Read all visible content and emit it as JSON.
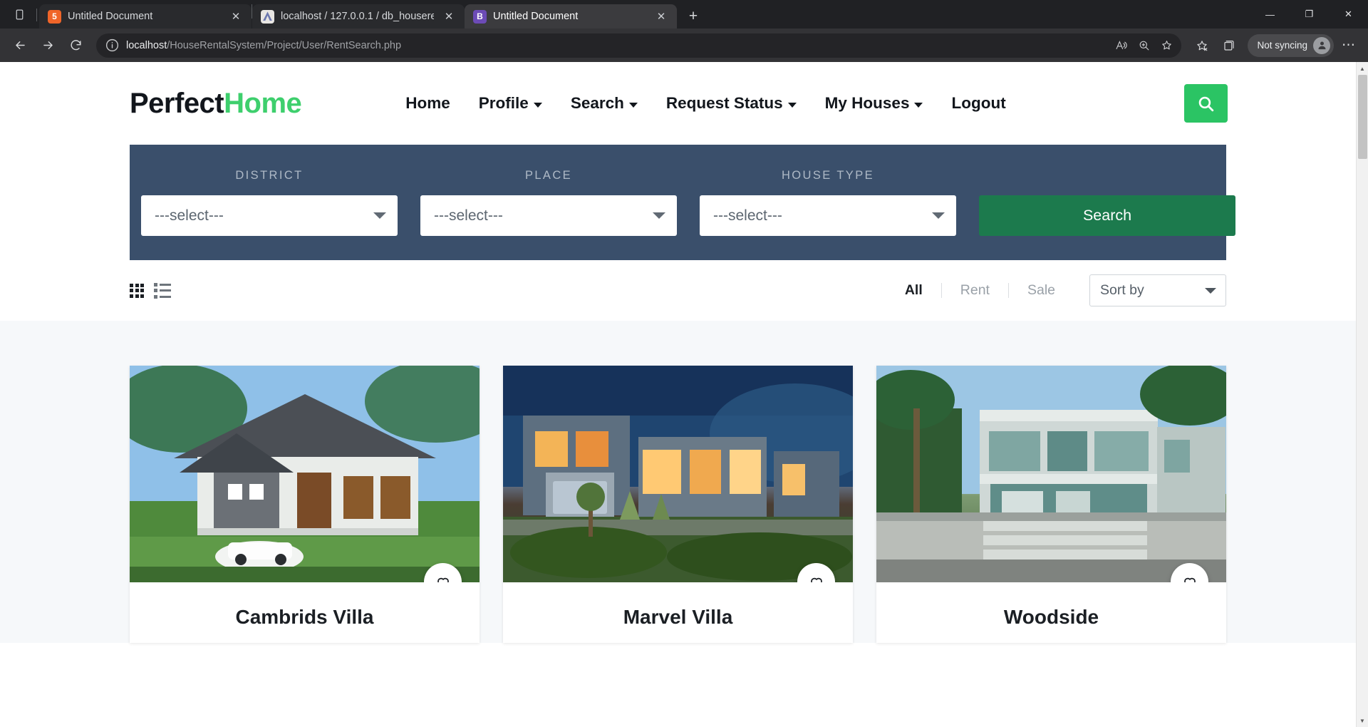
{
  "browser": {
    "tabs": [
      {
        "title": "Untitled Document",
        "favicon": "html5-icon",
        "active": false
      },
      {
        "title": "localhost / 127.0.0.1 / db_housere",
        "favicon": "phpmyadmin-icon",
        "active": false
      },
      {
        "title": "Untitled Document",
        "favicon": "bootstrap-icon",
        "active": true
      }
    ],
    "newtab_label": "+",
    "close_label": "✕",
    "window": {
      "minimize": "—",
      "maximize": "❐",
      "close": "✕"
    },
    "toolbar": {
      "back": "back-arrow",
      "forward": "forward-arrow",
      "reload": "reload-arrow",
      "url_host": "localhost",
      "url_path": "/HouseRentalSystem/Project/User/RentSearch.php",
      "sync_label": "Not syncing",
      "more_label": "⋯"
    }
  },
  "site": {
    "logo": {
      "part1": "Perfect",
      "part2": "Home"
    },
    "nav": [
      {
        "label": "Home",
        "dropdown": false
      },
      {
        "label": "Profile",
        "dropdown": true
      },
      {
        "label": "Search",
        "dropdown": true
      },
      {
        "label": "Request Status",
        "dropdown": true
      },
      {
        "label": "My Houses",
        "dropdown": true
      },
      {
        "label": "Logout",
        "dropdown": false
      }
    ],
    "header_search_icon": "search-icon"
  },
  "search_panel": {
    "fields": [
      {
        "label": "DISTRICT",
        "value": "---select---"
      },
      {
        "label": "PLACE",
        "value": "---select---"
      },
      {
        "label": "HOUSE TYPE",
        "value": "---select---"
      }
    ],
    "submit_label": "Search",
    "accent_bg": "#3a4f6b",
    "submit_bg": "#1c7a4d"
  },
  "listbar": {
    "view_modes": [
      {
        "name": "grid-view",
        "active": true
      },
      {
        "name": "list-view",
        "active": false
      }
    ],
    "segments": [
      {
        "label": "All",
        "active": true
      },
      {
        "label": "Rent",
        "active": false
      },
      {
        "label": "Sale",
        "active": false
      }
    ],
    "sort": {
      "value": "Sort by"
    }
  },
  "results": {
    "cards": [
      {
        "title": "Cambrids Villa",
        "favorite_icon": "heart-icon",
        "style": "s1"
      },
      {
        "title": "Marvel Villa",
        "favorite_icon": "heart-icon",
        "style": "s2"
      },
      {
        "title": "Woodside",
        "favorite_icon": "heart-icon",
        "style": "s3"
      }
    ]
  }
}
